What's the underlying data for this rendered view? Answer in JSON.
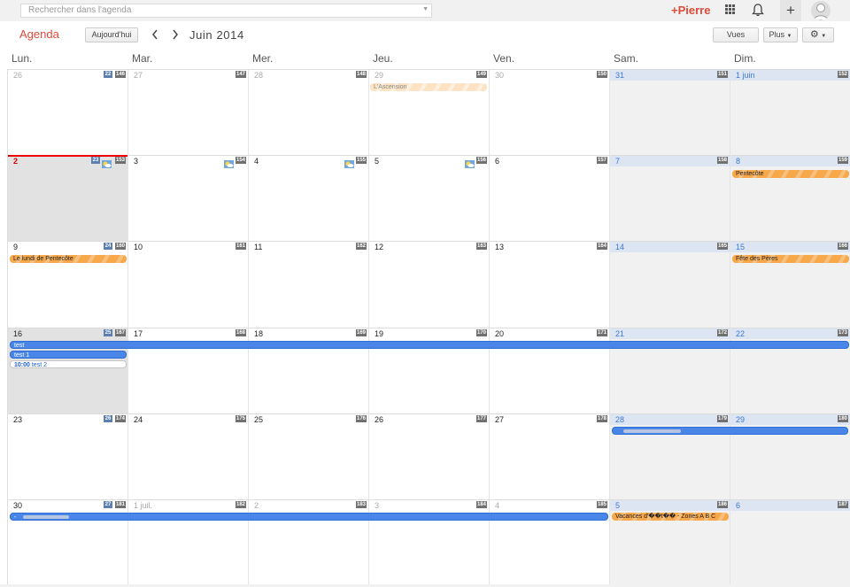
{
  "search": {
    "placeholder": "Rechercher dans l'agenda"
  },
  "header": {
    "user": "+Pierre"
  },
  "toolbar": {
    "app_title": "Agenda",
    "today_label": "Aujourd'hui",
    "month_title": "Juin 2014",
    "views_label": "Vues",
    "more_label": "Plus",
    "prev_symbol": "‹",
    "next_symbol": "›"
  },
  "days": [
    "Lun.",
    "Mar.",
    "Mer.",
    "Jeu.",
    "Ven.",
    "Sam.",
    "Dim."
  ],
  "weeks": [
    {
      "week_no": "22",
      "cells": [
        {
          "label": "26",
          "doy": "146",
          "muted": true
        },
        {
          "label": "27",
          "doy": "147",
          "muted": true
        },
        {
          "label": "28",
          "doy": "148",
          "muted": true
        },
        {
          "label": "29",
          "doy": "149",
          "muted": true
        },
        {
          "label": "30",
          "doy": "150",
          "muted": true
        },
        {
          "label": "31",
          "doy": "151",
          "muted": true
        },
        {
          "label": "1 juin",
          "doy": "152"
        }
      ]
    },
    {
      "week_no": "23",
      "cells": [
        {
          "label": "2",
          "doy": "153",
          "today": true,
          "weather": true
        },
        {
          "label": "3",
          "doy": "154",
          "weather": true
        },
        {
          "label": "4",
          "doy": "155",
          "weather": true
        },
        {
          "label": "5",
          "doy": "156",
          "weather": true
        },
        {
          "label": "6",
          "doy": "157"
        },
        {
          "label": "7",
          "doy": "158"
        },
        {
          "label": "8",
          "doy": "159"
        }
      ]
    },
    {
      "week_no": "24",
      "cells": [
        {
          "label": "9",
          "doy": "160"
        },
        {
          "label": "10",
          "doy": "161"
        },
        {
          "label": "11",
          "doy": "162"
        },
        {
          "label": "12",
          "doy": "163"
        },
        {
          "label": "13",
          "doy": "164"
        },
        {
          "label": "14",
          "doy": "165"
        },
        {
          "label": "15",
          "doy": "166"
        }
      ]
    },
    {
      "week_no": "25",
      "cells": [
        {
          "label": "16",
          "doy": "167"
        },
        {
          "label": "17",
          "doy": "168"
        },
        {
          "label": "18",
          "doy": "169"
        },
        {
          "label": "19",
          "doy": "170"
        },
        {
          "label": "20",
          "doy": "171"
        },
        {
          "label": "21",
          "doy": "172"
        },
        {
          "label": "22",
          "doy": "173"
        }
      ]
    },
    {
      "week_no": "26",
      "cells": [
        {
          "label": "23",
          "doy": "174"
        },
        {
          "label": "24",
          "doy": "175"
        },
        {
          "label": "25",
          "doy": "176"
        },
        {
          "label": "26",
          "doy": "177"
        },
        {
          "label": "27",
          "doy": "178"
        },
        {
          "label": "28",
          "doy": "179"
        },
        {
          "label": "29",
          "doy": "180"
        }
      ]
    },
    {
      "week_no": "27",
      "cells": [
        {
          "label": "30",
          "doy": "181"
        },
        {
          "label": "1 juil.",
          "doy": "182",
          "muted": true
        },
        {
          "label": "2",
          "doy": "183",
          "muted": true
        },
        {
          "label": "3",
          "doy": "184",
          "muted": true
        },
        {
          "label": "4",
          "doy": "185",
          "muted": true
        },
        {
          "label": "5",
          "doy": "186"
        },
        {
          "label": "6",
          "doy": "187"
        }
      ]
    }
  ],
  "events": {
    "ascension": "L'Ascension",
    "pentecote": "Pentecôte",
    "lundi_pentecote": "Le lundi de Pentecôte",
    "fete_peres": "Fête des Pères",
    "test": "test",
    "test1": "test 1",
    "test2_time": "10:00",
    "test2": "test 2",
    "vacances": "Vacances d'��t�� - Zones A B C",
    "last_week_bar": "-"
  },
  "colors": {
    "accent": "#dd4b39",
    "event_blue": "#4a86e8",
    "holiday_orange": "#f6a84b",
    "weekend_header": "#dce5f1"
  }
}
